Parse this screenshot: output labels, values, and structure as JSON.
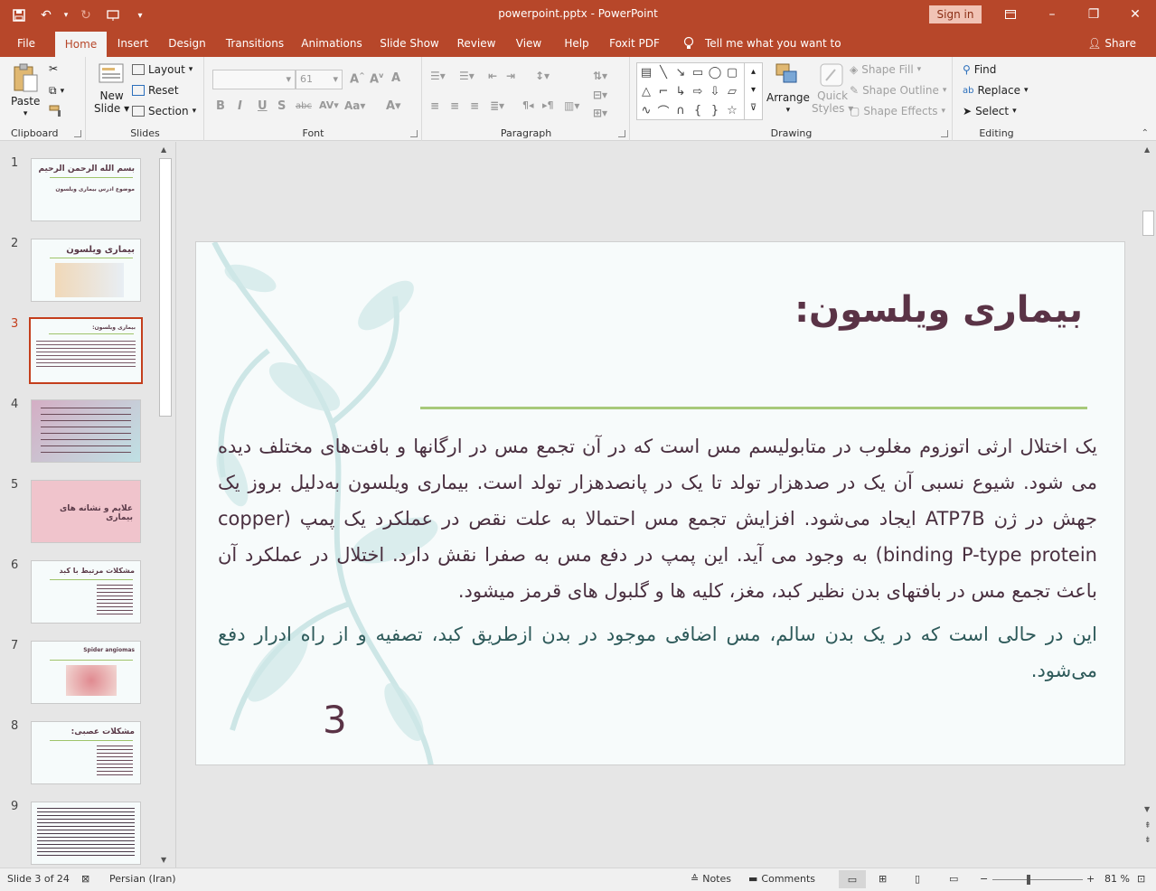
{
  "window": {
    "title": "powerpoint.pptx  -  PowerPoint",
    "sign_in": "Sign in",
    "share": "Share"
  },
  "menu": {
    "tabs": [
      "File",
      "Home",
      "Insert",
      "Design",
      "Transitions",
      "Animations",
      "Slide Show",
      "Review",
      "View",
      "Help",
      "Foxit PDF"
    ],
    "tell_me": "Tell me what you want to do"
  },
  "ribbon": {
    "clipboard": {
      "label": "Clipboard",
      "paste": "Paste"
    },
    "slides": {
      "label": "Slides",
      "new_slide_1": "New",
      "new_slide_2": "Slide",
      "layout": "Layout",
      "reset": "Reset",
      "section": "Section"
    },
    "font": {
      "label": "Font",
      "size": "61"
    },
    "paragraph": {
      "label": "Paragraph"
    },
    "drawing": {
      "label": "Drawing",
      "arrange": "Arrange",
      "quick_1": "Quick",
      "quick_2": "Styles",
      "shape_fill": "Shape Fill",
      "shape_outline": "Shape Outline",
      "shape_effects": "Shape Effects"
    },
    "editing": {
      "label": "Editing",
      "find": "Find",
      "replace": "Replace",
      "select": "Select"
    }
  },
  "thumbnails": [
    {
      "num": "1",
      "title": "بسم الله الرحمن الرحیم",
      "subtitle": "موضوع ادرس بیماری ویلسون"
    },
    {
      "num": "2",
      "title": "بیماری ویلسون"
    },
    {
      "num": "3",
      "title": "بیماری ویلسون:"
    },
    {
      "num": "4",
      "title": ""
    },
    {
      "num": "5",
      "title": "علایم و نشانه های بیماری"
    },
    {
      "num": "6",
      "title": "مشکلات مرتبط با کبد"
    },
    {
      "num": "7",
      "title": "Spider angiomas"
    },
    {
      "num": "8",
      "title": "مشکلات عصبی:"
    },
    {
      "num": "9",
      "title": ""
    }
  ],
  "slide": {
    "title": "بیماری ویلسون:",
    "paragraph1": "یک اختلال ارثی اتوزوم مغلوب در متابولیسم مس است که در آن تجمع مس در ارگانها و بافت‌های مختلف دیده می شود. شیوع نسبی آن یک در صدهزار تولد تا یک در پانصدهزار تولد است. بیماری ویلسون به‌دلیل بروز یک جهش در ژن ATP7B ایجاد می‌شود. افزایش تجمع مس احتمالا به علت نقص در عملکرد یک پمپ  (copper binding P-type protein) به وجود می آید. این پمپ در دفع مس به صفرا نقش دارد. اختلال در عملکرد آن باعث تجمع مس در بافتهای بدن نظیر کبد، مغز، کلیه ها و گلبول های قرمز میشود.",
    "paragraph2": "این در حالی است که در یک بدن سالم، مس اضافی موجود در بدن ازطریق کبد، تصفیه و از راه ادرار دفع می‌شود.",
    "number": "3"
  },
  "status": {
    "slide_info": "Slide 3 of 24",
    "language": "Persian (Iran)",
    "notes": "Notes",
    "comments": "Comments",
    "zoom": "81 %"
  },
  "colors": {
    "accent": "#b7472a",
    "title": "#5a3346",
    "rule": "#a7c97a"
  }
}
